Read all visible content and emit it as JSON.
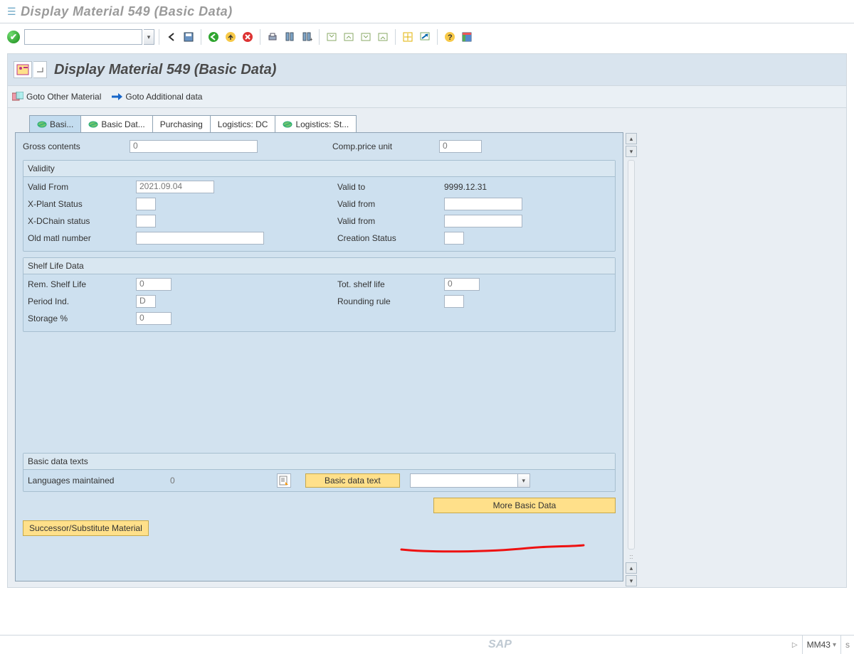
{
  "window_title": "Display Material 549 (Basic Data)",
  "appheader_title": "Display Material 549 (Basic Data)",
  "subbar": {
    "goto_other": "Goto Other Material",
    "goto_additional": "Goto Additional data"
  },
  "tabs": {
    "t1": "Basi...",
    "t2": "Basic Dat...",
    "t3": "Purchasing",
    "t4": "Logistics: DC",
    "t5": "Logistics: St..."
  },
  "top_fields": {
    "gross_contents_lbl": "Gross contents",
    "gross_contents_val": "0",
    "comp_price_lbl": "Comp.price unit",
    "comp_price_val": "0"
  },
  "validity": {
    "group_title": "Validity",
    "valid_from_lbl": "Valid From",
    "valid_from_val": "2021.09.04",
    "valid_to_lbl": "Valid to",
    "valid_to_val": "9999.12.31",
    "xplant_lbl": "X-Plant Status",
    "xplant_val": "",
    "valid_from2_lbl": "Valid from",
    "valid_from2_val": "",
    "xdchain_lbl": "X-DChain status",
    "xdchain_val": "",
    "valid_from3_lbl": "Valid from",
    "valid_from3_val": "",
    "old_matl_lbl": "Old matl number",
    "old_matl_val": "",
    "creation_lbl": "Creation Status",
    "creation_val": ""
  },
  "shelf": {
    "group_title": "Shelf Life Data",
    "rem_lbl": "Rem. Shelf Life",
    "rem_val": "0",
    "tot_lbl": "Tot. shelf life",
    "tot_val": "0",
    "period_lbl": "Period Ind.",
    "period_val": "D",
    "rounding_lbl": "Rounding rule",
    "rounding_val": "",
    "storage_lbl": "Storage %",
    "storage_val": "0"
  },
  "texts": {
    "group_title": "Basic data texts",
    "lang_lbl": "Languages maintained",
    "lang_val": "0",
    "bdt_btn": "Basic data text"
  },
  "footer_buttons": {
    "more_basic": "More Basic Data",
    "successor": "Successor/Substitute Material"
  },
  "status": {
    "tcode": "MM43"
  }
}
